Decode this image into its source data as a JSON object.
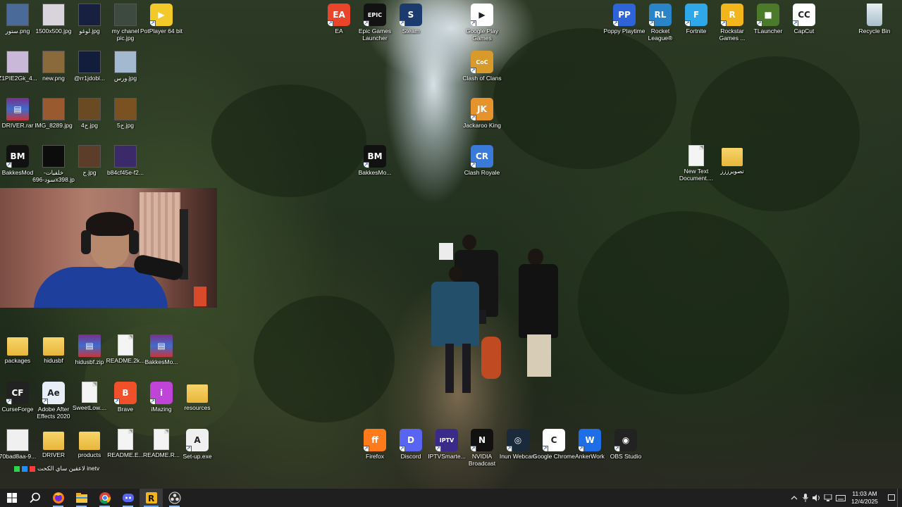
{
  "desktop": {
    "icons": [
      {
        "label": "ستور.png",
        "kind": "photo",
        "color": "#4a6a9a"
      },
      {
        "label": "1500x500.jpg",
        "kind": "photo",
        "color": "#d9d4dc"
      },
      {
        "label": "لوغو.jpg",
        "kind": "photo",
        "color": "#182040"
      },
      {
        "label": "my chanel pic.jpg",
        "kind": "photo",
        "color": "#3d4a40"
      },
      {
        "label": "PotPlayer 64 bit",
        "kind": "app",
        "color": "#f3c92a",
        "glyph": "▶"
      },
      {
        "label": "Z1PIE2Gk_4...",
        "kind": "photo",
        "color": "#c9b8d8"
      },
      {
        "label": "new.png",
        "kind": "photo",
        "color": "#8a6a3a"
      },
      {
        "label": "@rr1jdobl...",
        "kind": "photo",
        "color": "#111d3a"
      },
      {
        "label": "ورس.jpg",
        "kind": "photo",
        "color": "#a3b9cf"
      },
      {
        "label": "DRIVER.rar",
        "kind": "zip"
      },
      {
        "label": "IMG_8289.jpg",
        "kind": "photo",
        "color": "#9a5a30"
      },
      {
        "label": "4ج.jpg",
        "kind": "photo",
        "color": "#6a4a22"
      },
      {
        "label": "5ج.jpg",
        "kind": "photo",
        "color": "#7a5222"
      },
      {
        "label": "BakkesMod",
        "kind": "app",
        "color": "#111",
        "glyph": "BM"
      },
      {
        "label": "خلفيات-سود-696x398.jpg",
        "kind": "photo",
        "color": "#0c0c0c"
      },
      {
        "label": "ج.jpg",
        "kind": "photo",
        "color": "#5b3d2a"
      },
      {
        "label": "b84cf45e-f2...",
        "kind": "photo",
        "color": "#3a2a6a"
      },
      {
        "label": "EA",
        "kind": "app",
        "color": "#e8452a",
        "glyph": "EA"
      },
      {
        "label": "Epic Games Launcher",
        "kind": "app",
        "color": "#121212",
        "glyph": "EPIC"
      },
      {
        "label": "Steam",
        "kind": "app",
        "color": "#1b3b6f",
        "glyph": "S"
      },
      {
        "label": "Google Play Games",
        "kind": "app",
        "color": "#ffffff",
        "glyph": "▶"
      },
      {
        "label": "Clash of Clans",
        "kind": "app",
        "color": "#d89a2a",
        "glyph": "CoC"
      },
      {
        "label": "Jackaroo King",
        "kind": "app",
        "color": "#e5932a",
        "glyph": "JK"
      },
      {
        "label": "Clash Royale",
        "kind": "app",
        "color": "#3a7ad9",
        "glyph": "CR"
      },
      {
        "label": "BakkesMo...",
        "kind": "app",
        "color": "#111",
        "glyph": "BM"
      },
      {
        "label": "Poppy Playtime",
        "kind": "app",
        "color": "#2f63d8",
        "glyph": "PP"
      },
      {
        "label": "Rocket League®",
        "kind": "app",
        "color": "#2a84c8",
        "glyph": "RL"
      },
      {
        "label": "Fortnite",
        "kind": "app",
        "color": "#2ea8e8",
        "glyph": "F"
      },
      {
        "label": "Rockstar Games ...",
        "kind": "app",
        "color": "#f2b51b",
        "glyph": "R"
      },
      {
        "label": "TLauncher",
        "kind": "app",
        "color": "#4a7a2a",
        "glyph": "■"
      },
      {
        "label": "CapCut",
        "kind": "app",
        "color": "#ffffff",
        "glyph": "CC"
      },
      {
        "label": "Recycle Bin",
        "kind": "bin"
      },
      {
        "label": "New Text Document....",
        "kind": "file"
      },
      {
        "label": "تصويرززز",
        "kind": "folder"
      },
      {
        "label": "packages",
        "kind": "folder"
      },
      {
        "label": "hidusbf",
        "kind": "folder"
      },
      {
        "label": "hidusbf.zip",
        "kind": "zip"
      },
      {
        "label": "README.2k...",
        "kind": "file"
      },
      {
        "label": "BakkesMo...",
        "kind": "zip"
      },
      {
        "label": "CurseForge",
        "kind": "app",
        "color": "#222",
        "glyph": "CF"
      },
      {
        "label": "Adobe After Effects 2020",
        "kind": "app",
        "color": "#e8eef8",
        "glyph": "Ae"
      },
      {
        "label": "SweetLow....",
        "kind": "file"
      },
      {
        "label": "Brave",
        "kind": "app",
        "color": "#f0502a",
        "glyph": "B"
      },
      {
        "label": "iMazing",
        "kind": "app",
        "color": "#c044d8",
        "glyph": "i"
      },
      {
        "label": "resources",
        "kind": "folder"
      },
      {
        "label": "70bad8aa-9...",
        "kind": "photo",
        "color": "#f0f0f0"
      },
      {
        "label": "DRIVER",
        "kind": "folder"
      },
      {
        "label": "products",
        "kind": "folder"
      },
      {
        "label": "README.E...",
        "kind": "file"
      },
      {
        "label": "README.R...",
        "kind": "file"
      },
      {
        "label": "Set-up.exe",
        "kind": "app",
        "color": "#f0f0f0",
        "glyph": "A"
      },
      {
        "label": "Firefox",
        "kind": "app",
        "color": "#ff7a1a",
        "glyph": "ff"
      },
      {
        "label": "Discord",
        "kind": "app",
        "color": "#5865f2",
        "glyph": "D"
      },
      {
        "label": "IPTVSmarte...",
        "kind": "app",
        "color": "#3a2a8a",
        "glyph": "IPTV"
      },
      {
        "label": "NVIDIA Broadcast",
        "kind": "app",
        "color": "#111",
        "glyph": "N"
      },
      {
        "label": "Inun Webcam",
        "kind": "app",
        "color": "#1a2a3a",
        "glyph": "◎"
      },
      {
        "label": "Google Chrome",
        "kind": "app",
        "color": "#ffffff",
        "glyph": "C"
      },
      {
        "label": "AnkerWork",
        "kind": "app",
        "color": "#1e6ee8",
        "glyph": "W"
      },
      {
        "label": "OBS Studio",
        "kind": "app",
        "color": "#222",
        "glyph": "◉"
      }
    ],
    "ticker_text": "لاعقين ساي الكحت inetv"
  },
  "webcam": {
    "name": "webcam-overlay"
  },
  "taskbar": {
    "apps": [
      {
        "name": "start-button",
        "glyph": "⊞"
      },
      {
        "name": "search",
        "glyph": "⌕"
      },
      {
        "name": "firefox",
        "glyph": "ff"
      },
      {
        "name": "file-explorer",
        "glyph": "▬"
      },
      {
        "name": "chrome",
        "glyph": "C"
      },
      {
        "name": "discord",
        "glyph": "D"
      },
      {
        "name": "rockstar",
        "glyph": "R"
      },
      {
        "name": "obs",
        "glyph": "◉"
      }
    ],
    "clock": {
      "time": "11:03 AM",
      "date": "12/4/2025"
    }
  },
  "colors": {
    "taskbar": "#1f1f1f",
    "accent": "#6aa7e8"
  }
}
